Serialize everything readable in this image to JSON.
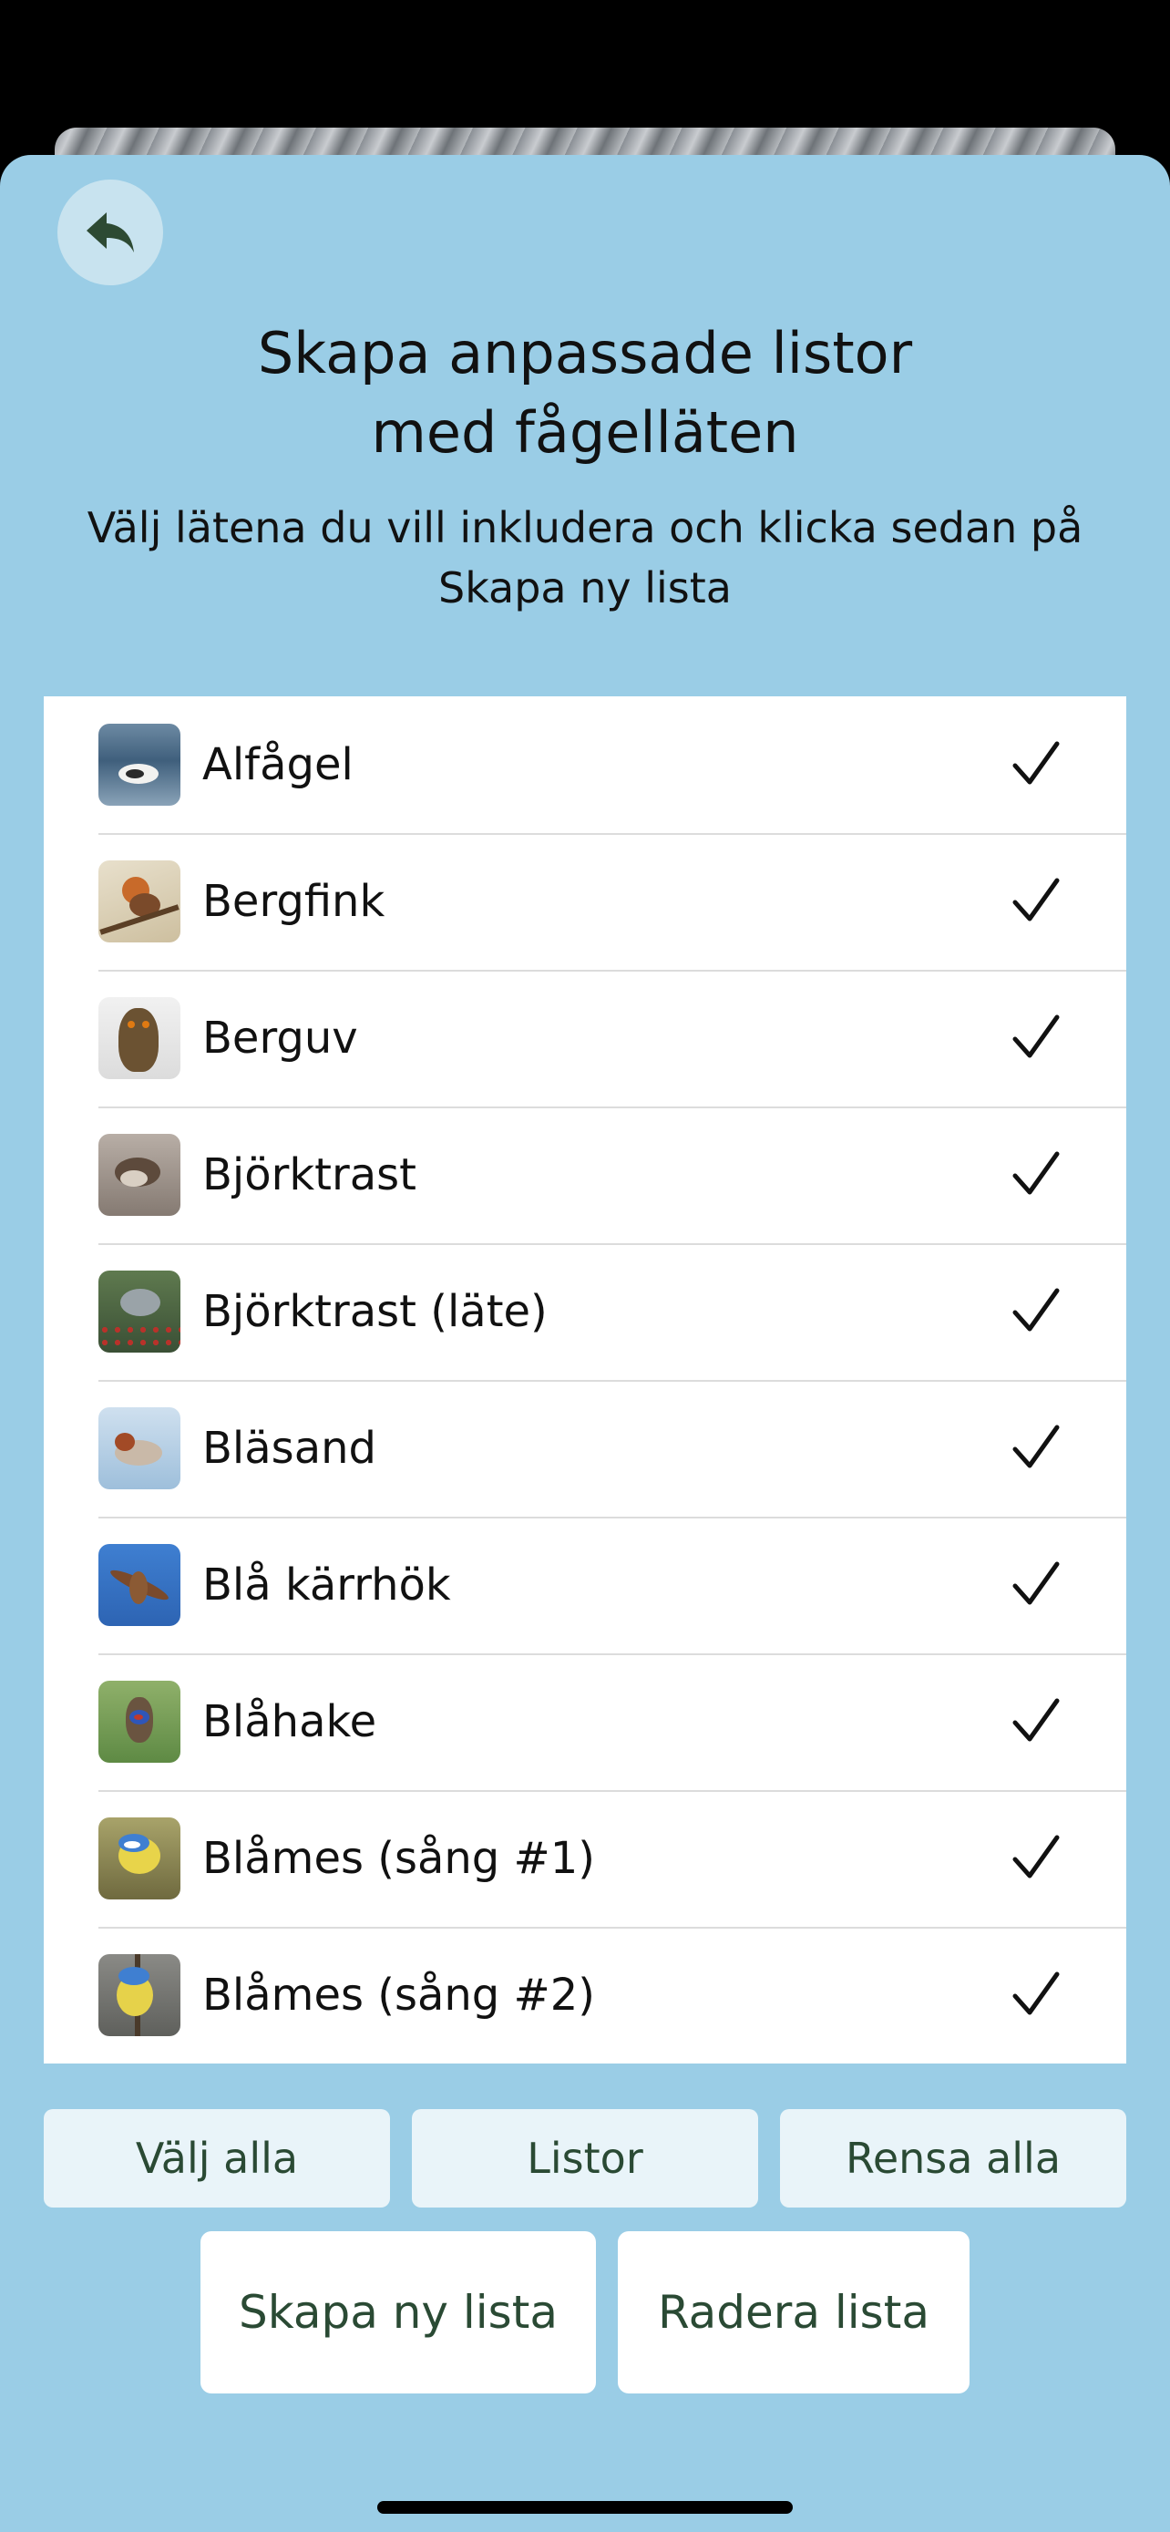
{
  "header": {
    "back_icon": "back-arrow-icon",
    "title_line1": "Skapa anpassade listor",
    "title_line2": "med fågelläten",
    "subtitle_line1": "Välj lätena du vill inkludera och klicka sedan på",
    "subtitle_line2": "Skapa ny lista"
  },
  "birds": [
    {
      "label": "Alfågel",
      "checked": true
    },
    {
      "label": "Bergfink",
      "checked": true
    },
    {
      "label": "Berguv",
      "checked": true
    },
    {
      "label": "Björktrast",
      "checked": true
    },
    {
      "label": "Björktrast (läte)",
      "checked": true
    },
    {
      "label": "Bläsand",
      "checked": true
    },
    {
      "label": "Blå kärrhök",
      "checked": true
    },
    {
      "label": "Blåhake",
      "checked": true
    },
    {
      "label": "Blåmes (sång #1)",
      "checked": true
    },
    {
      "label": "Blåmes (sång #2)",
      "checked": true
    }
  ],
  "buttons": {
    "select_all": "Välj alla",
    "lists": "Listor",
    "clear_all": "Rensa alla",
    "create_list": "Skapa ny lista",
    "delete_list": "Radera lista"
  },
  "colors": {
    "sheet_bg": "#9acde6",
    "button_text": "#2a4a34",
    "back_icon": "#2d4a33"
  }
}
